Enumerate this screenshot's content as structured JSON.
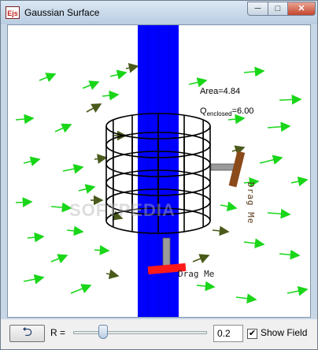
{
  "window": {
    "title": "Gaussian Surface",
    "app_icon_text": "Ejs",
    "minimize_glyph": "─",
    "maximize_glyph": "□",
    "close_glyph": "✕"
  },
  "scene": {
    "area_text": "Area=4.84",
    "charge_prefix": "Q",
    "charge_subscript": "enclosed",
    "charge_value": "=6.00",
    "drag_label_1": "Drag Me",
    "drag_label_2": "Drag Me",
    "watermark": "SOFTPEDIA",
    "colors": {
      "wire": "#0000ff",
      "field_arrows": "#19d619",
      "dark_arrows": "#4a5a1a",
      "charge_marker": "#ff1a1a",
      "handle": "#8b4a1a",
      "surface": "#000000"
    }
  },
  "controls": {
    "reset_icon": "undo-arrow-icon",
    "reset_glyph": "⮌",
    "r_label": "R =",
    "r_value": "0.2",
    "show_field_checked": true,
    "checkbox_glyph": "✔",
    "show_field_label": "Show Field"
  }
}
